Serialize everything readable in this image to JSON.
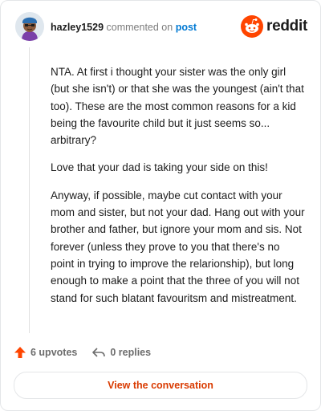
{
  "comment": {
    "username": "hazley1529",
    "action": "commented on",
    "post_link": "post",
    "paragraphs": [
      "NTA. At first i thought your sister was the only girl (but she isn't) or that she was the youngest (ain't that too). These are the most common reasons for a kid being the favourite child but it just seems so... arbitrary?",
      "Love that your dad is taking your side on this!",
      "Anyway, if possible, maybe cut contact with your mom and sister, but not your dad. Hang out with your brother and father, but ignore your mom and sis. Not forever (unless they prove to you that there's no point in trying to improve the relarionship), but long enough to make a point that the three of you will not stand for such blatant favouritsm and mistreatment."
    ]
  },
  "brand": {
    "name": "reddit",
    "color": "#ff4500",
    "icon": "reddit-snoo-icon"
  },
  "footer": {
    "upvotes": "6 upvotes",
    "replies": "0 replies",
    "upvote_icon": "upvote-arrow-icon",
    "reply_icon": "reply-arrow-icon",
    "upvote_color": "#ff4500"
  },
  "view_button": {
    "label": "View the conversation",
    "color": "#d93a00"
  }
}
